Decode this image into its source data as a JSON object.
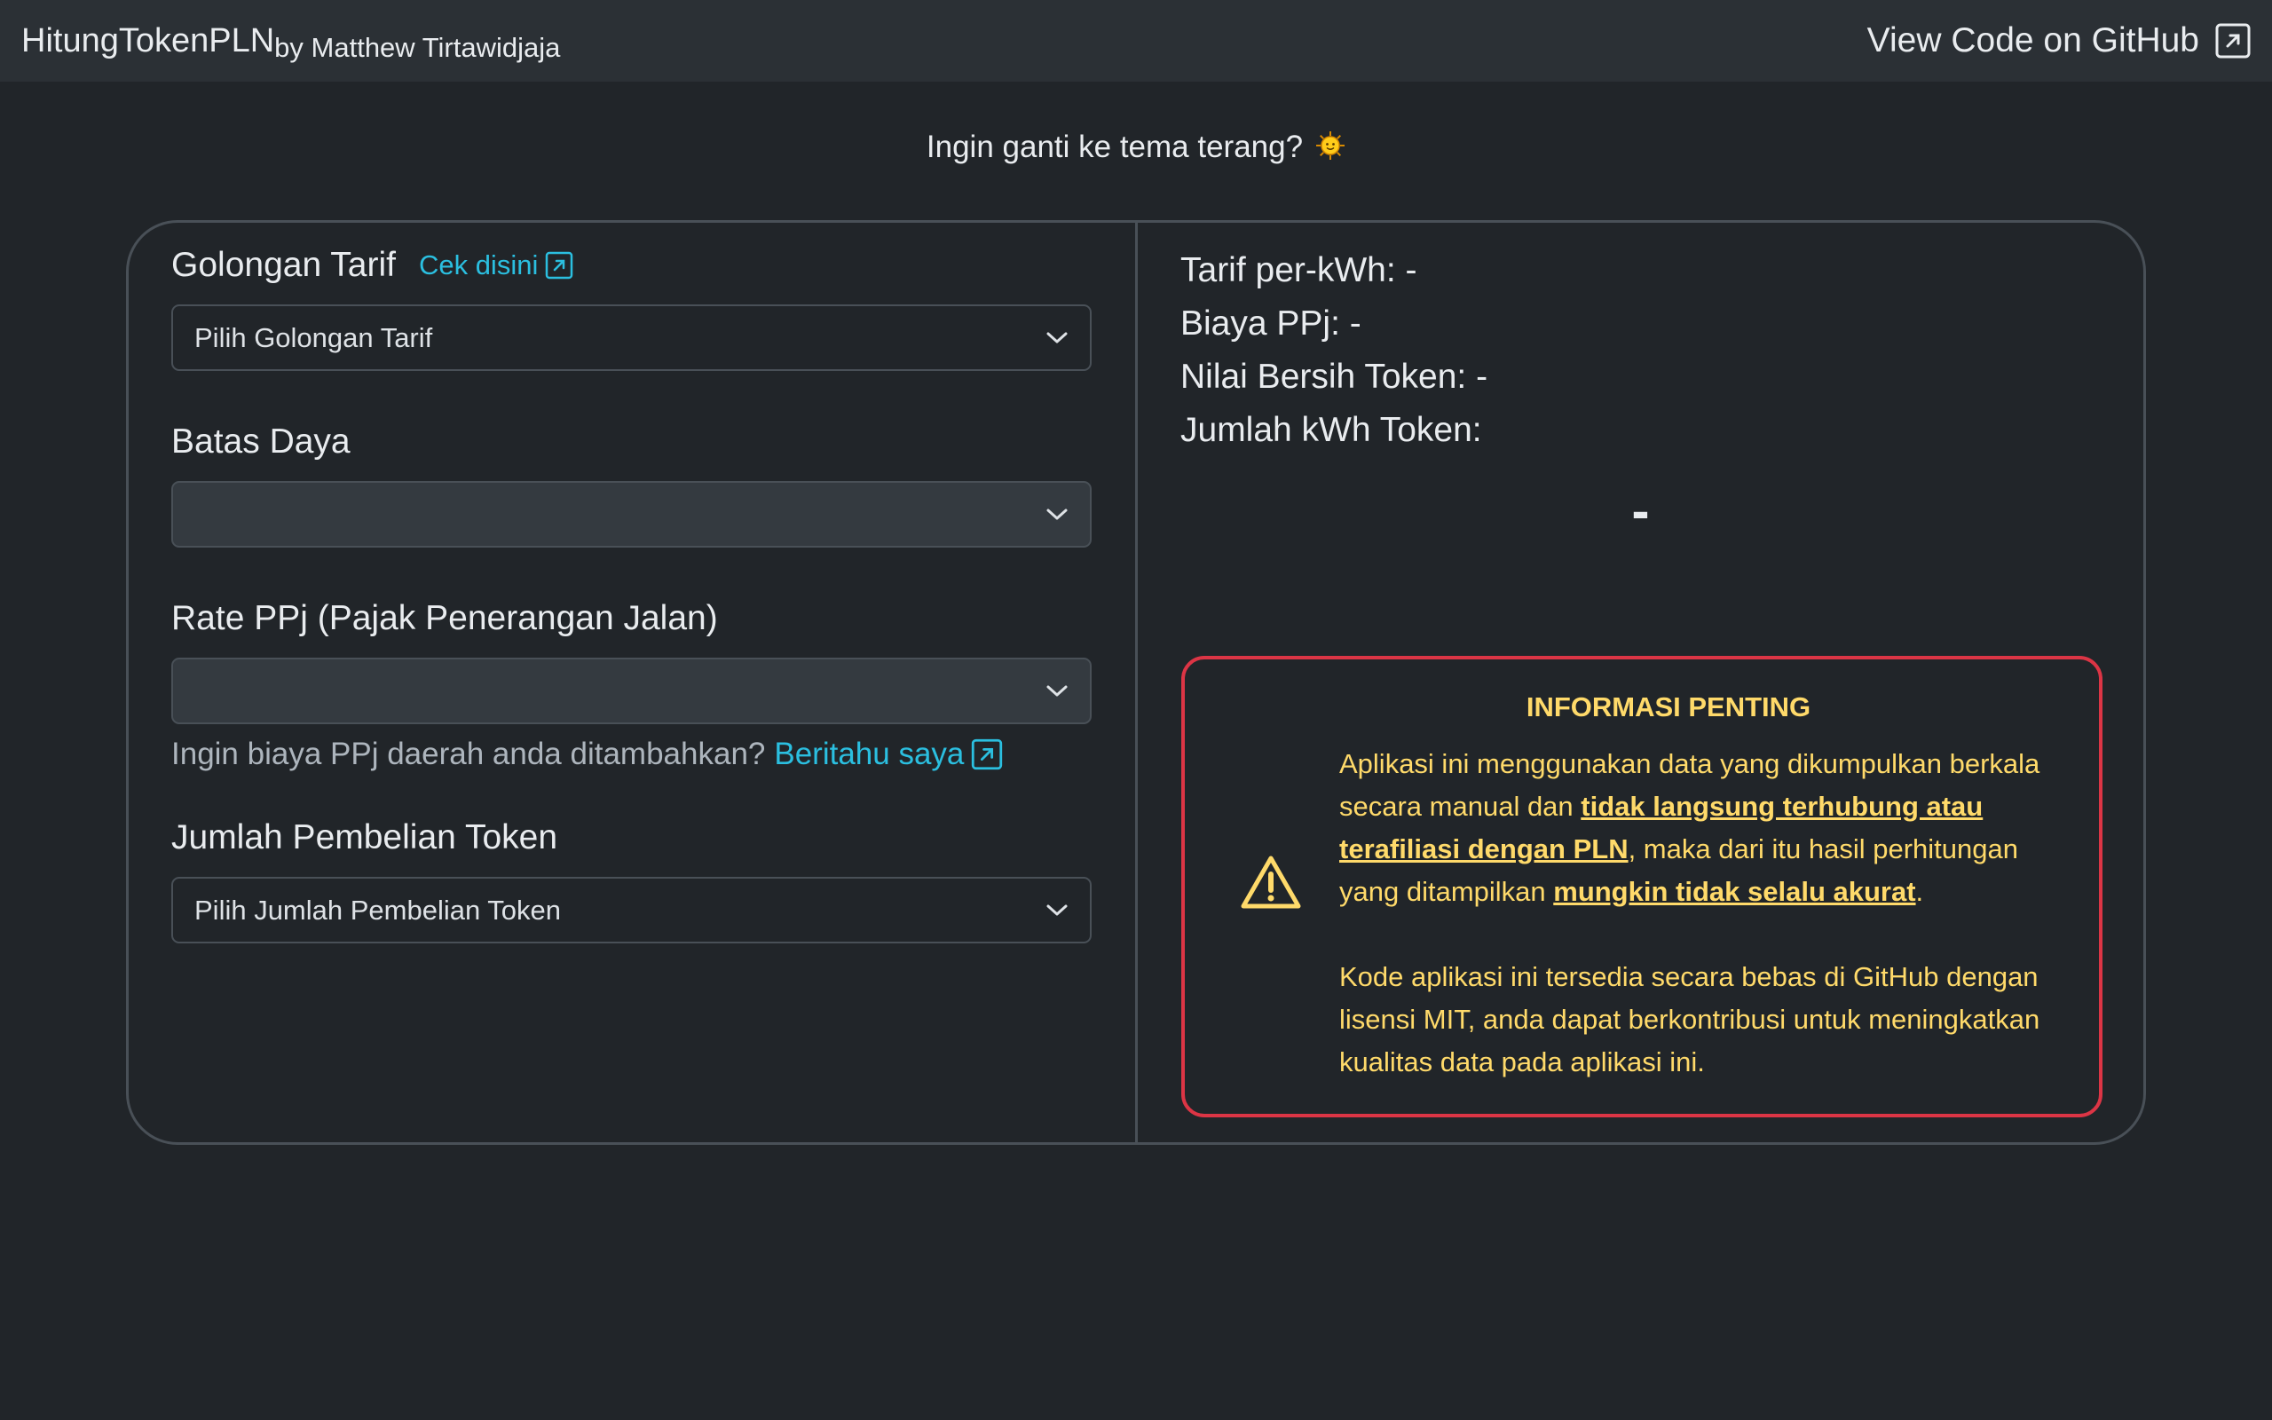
{
  "navbar": {
    "brand": "HitungTokenPLN",
    "author": "by Matthew Tirtawidjaja",
    "github_link": "View Code on GitHub"
  },
  "theme_toggle": {
    "text": "Ingin ganti ke tema terang?",
    "icon": "sun-icon"
  },
  "form": {
    "tariff": {
      "label": "Golongan Tarif",
      "check_link": "Cek disini",
      "selected": "Pilih Golongan Tarif"
    },
    "power_limit": {
      "label": "Batas Daya",
      "selected": ""
    },
    "ppj_rate": {
      "label": "Rate PPj (Pajak Penerangan Jalan)",
      "selected": "",
      "helper_text": "Ingin biaya PPj daerah anda ditambahkan?",
      "helper_link": "Beritahu saya"
    },
    "token_amount": {
      "label": "Jumlah Pembelian Token",
      "selected": "Pilih Jumlah Pembelian Token"
    }
  },
  "results": {
    "tariff_per_kwh": "Tarif per-kWh: -",
    "ppj_cost": "Biaya PPj: -",
    "net_token_value": "Nilai Bersih Token: -",
    "kwh_amount_label": "Jumlah kWh Token:",
    "kwh_amount_value": "-"
  },
  "alert": {
    "title": "INFORMASI PENTING",
    "p1_a": "Aplikasi ini menggunakan data yang dikumpulkan berkala secara manual dan ",
    "p1_b": "tidak langsung terhubung atau terafiliasi dengan PLN",
    "p1_c": ", maka dari itu hasil perhitungan yang ditampilkan ",
    "p1_d": "mungkin tidak selalu akurat",
    "p1_e": ".",
    "p2": "Kode aplikasi ini tersedia secara bebas di GitHub dengan lisensi MIT, anda dapat berkontribusi untuk meningkatkan kualitas data pada aplikasi ini."
  },
  "colors": {
    "background": "#212529",
    "navbar": "#2b3035",
    "link": "#2bbfe0",
    "alert_border": "#dc3545",
    "alert_text": "#ffda6a"
  }
}
